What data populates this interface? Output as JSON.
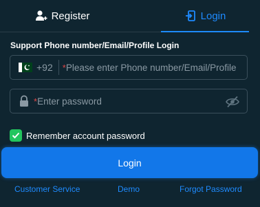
{
  "tabs": {
    "register_label": "Register",
    "login_label": "Login",
    "active": "login"
  },
  "form": {
    "title": "Support Phone number/Email/Profile Login",
    "phone": {
      "country_code": "+92",
      "flag_icon": "pakistan-flag-icon",
      "required_mark": "*",
      "placeholder": "Please enter Phone number/Email/Profile"
    },
    "password": {
      "required_mark": "*",
      "placeholder": "Enter password"
    },
    "remember": {
      "label": "Remember account password",
      "checked": true
    },
    "login_button": "Login"
  },
  "links": {
    "customer_service": "Customer Service",
    "demo": "Demo",
    "forgot_password": "Forgot Password"
  },
  "colors": {
    "background": "#0f2530",
    "accent": "#1e8bff",
    "button": "#1277e9",
    "checkbox": "#22c55e",
    "required": "#e04848",
    "placeholder": "#8a99a3"
  }
}
